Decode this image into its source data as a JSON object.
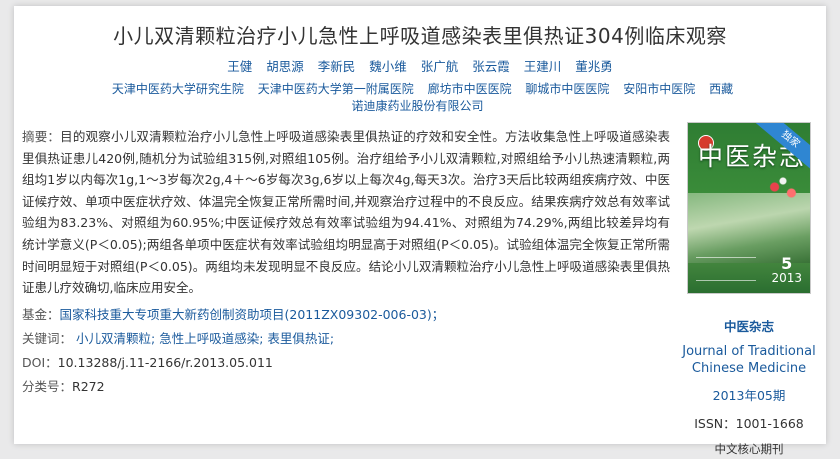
{
  "article": {
    "title": "小儿双清颗粒治疗小儿急性上呼吸道感染表里俱热证304例临床观察",
    "authors": [
      "王健",
      "胡思源",
      "李新民",
      "魏小维",
      "张广航",
      "张云霞",
      "王建川",
      "董兆勇"
    ],
    "affiliations": [
      "天津中医药大学研究生院",
      "天津中医药大学第一附属医院",
      "廊坊市中医医院",
      "聊城市中医医院",
      "安阳市中医院",
      "西藏诺迪康药业股份有限公司"
    ],
    "abstract_label": "摘要：",
    "abstract": "目的观察小儿双清颗粒治疗小儿急性上呼吸道感染表里俱热证的疗效和安全性。方法收集急性上呼吸道感染表里俱热证患儿420例,随机分为试验组315例,对照组105例。治疗组给予小儿双清颗粒,对照组给予小儿热速清颗粒,两组均1岁以内每次1g,1～3岁每次2g,4＋～6岁每次3g,6岁以上每次4g,每天3次。治疗3天后比较两组疾病疗效、中医证候疗效、单项中医症状疗效、体温完全恢复正常所需时间,并观察治疗过程中的不良反应。结果疾病疗效总有效率试验组为83.23%、对照组为60.95%;中医证候疗效总有效率试验组为94.41%、对照组为74.29%,两组比较差异均有统计学意义(P＜0.05);两组各单项中医症状有效率试验组均明显高于对照组(P＜0.05)。试验组体温完全恢复正常所需时间明显短于对照组(P＜0.05)。两组均未发现明显不良反应。结论小儿双清颗粒治疗小儿急性上呼吸道感染表里俱热证患儿疗效确切,临床应用安全。",
    "fund_label": "基金：",
    "fund": "国家科技重大专项重大新药创制资助项目(2011ZX09302-006-03)；",
    "keywords_label": "关键词：",
    "keywords": [
      "小儿双清颗粒;",
      "急性上呼吸道感染;",
      "表里俱热证;"
    ],
    "doi_label": "DOI：",
    "doi": "10.13288/j.11-2166/r.2013.05.011",
    "class_label": "分类号：",
    "class_no": "R272"
  },
  "journal": {
    "cover_title": "中医杂志",
    "cover_badge": "独家",
    "cover_issue_number": "5",
    "cover_issue_year": "2013",
    "name_cn": "中医杂志",
    "name_en": "Journal of Traditional Chinese Medicine",
    "issue": "2013年05期",
    "issn": "ISSN：1001-1668",
    "core_label": "中文核心期刊"
  },
  "colors": {
    "link": "#1a5a9c",
    "text": "#333333",
    "background": "#e9e9ea",
    "cover_green": "#2f7d33"
  }
}
